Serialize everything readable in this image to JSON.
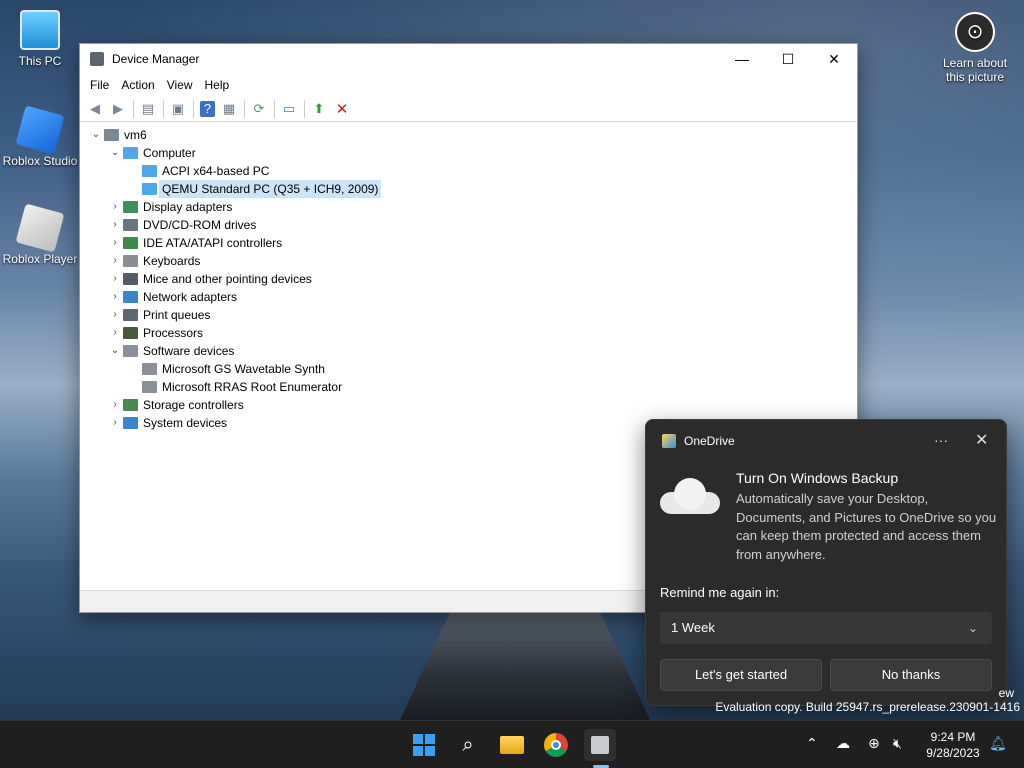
{
  "desktop": {
    "icons": [
      {
        "label": "This PC"
      },
      {
        "label": "Roblox Studio"
      },
      {
        "label": "Roblox Player"
      }
    ],
    "learn": {
      "line1": "Learn about",
      "line2": "this picture"
    },
    "watermark": {
      "line1": "ew",
      "line2": "Evaluation copy. Build 25947.rs_prerelease.230901-1416"
    }
  },
  "window": {
    "title": "Device Manager",
    "controls": {
      "minimize": "—",
      "maximize": "☐",
      "close": "✕"
    },
    "menu": [
      "File",
      "Action",
      "View",
      "Help"
    ],
    "tree": [
      {
        "label": "vm6",
        "level": 0,
        "expanded": true,
        "icon": "computer-root-icon",
        "color": "#7a8896"
      },
      {
        "label": "Computer",
        "level": 1,
        "expanded": true,
        "icon": "monitor-icon",
        "color": "#4ea7e6"
      },
      {
        "label": "ACPI x64-based PC",
        "level": 2,
        "icon": "monitor-icon",
        "color": "#4ea7e6"
      },
      {
        "label": "QEMU Standard PC (Q35 + ICH9, 2009)",
        "level": 2,
        "icon": "monitor-icon",
        "color": "#4ea7e6",
        "selected": true
      },
      {
        "label": "Display adapters",
        "level": 1,
        "expanded": false,
        "icon": "display-adapter-icon",
        "color": "#3f8f5a"
      },
      {
        "label": "DVD/CD-ROM drives",
        "level": 1,
        "expanded": false,
        "icon": "dvd-drive-icon",
        "color": "#6b7580"
      },
      {
        "label": "IDE ATA/ATAPI controllers",
        "level": 1,
        "expanded": false,
        "icon": "ide-controller-icon",
        "color": "#3d8a4a"
      },
      {
        "label": "Keyboards",
        "level": 1,
        "expanded": false,
        "icon": "keyboard-icon",
        "color": "#8a8f96"
      },
      {
        "label": "Mice and other pointing devices",
        "level": 1,
        "expanded": false,
        "icon": "mouse-icon",
        "color": "#555c63"
      },
      {
        "label": "Network adapters",
        "level": 1,
        "expanded": false,
        "icon": "network-adapter-icon",
        "color": "#3a86c8"
      },
      {
        "label": "Print queues",
        "level": 1,
        "expanded": false,
        "icon": "printer-icon",
        "color": "#5f6670"
      },
      {
        "label": "Processors",
        "level": 1,
        "expanded": false,
        "icon": "processor-icon",
        "color": "#4b5a3e"
      },
      {
        "label": "Software devices",
        "level": 1,
        "expanded": true,
        "icon": "software-device-icon",
        "color": "#8a9098"
      },
      {
        "label": "Microsoft GS Wavetable Synth",
        "level": 2,
        "icon": "software-device-icon",
        "color": "#8a9098"
      },
      {
        "label": "Microsoft RRAS Root Enumerator",
        "level": 2,
        "icon": "software-device-icon",
        "color": "#8a9098"
      },
      {
        "label": "Storage controllers",
        "level": 1,
        "expanded": false,
        "icon": "storage-controller-icon",
        "color": "#4a8a52"
      },
      {
        "label": "System devices",
        "level": 1,
        "expanded": false,
        "icon": "system-devices-icon",
        "color": "#3a86c8"
      }
    ]
  },
  "toast": {
    "app": "OneDrive",
    "heading": "Turn On Windows Backup",
    "body": "Automatically save your Desktop, Documents, and Pictures to OneDrive so you can keep them protected and access them from anywhere.",
    "remind_label": "Remind me again in:",
    "remind_value": "1 Week",
    "primary": "Let's get started",
    "secondary": "No thanks",
    "more": "···",
    "close": "✕"
  },
  "taskbar": {
    "time": "9:24 PM",
    "date": "9/28/2023"
  }
}
